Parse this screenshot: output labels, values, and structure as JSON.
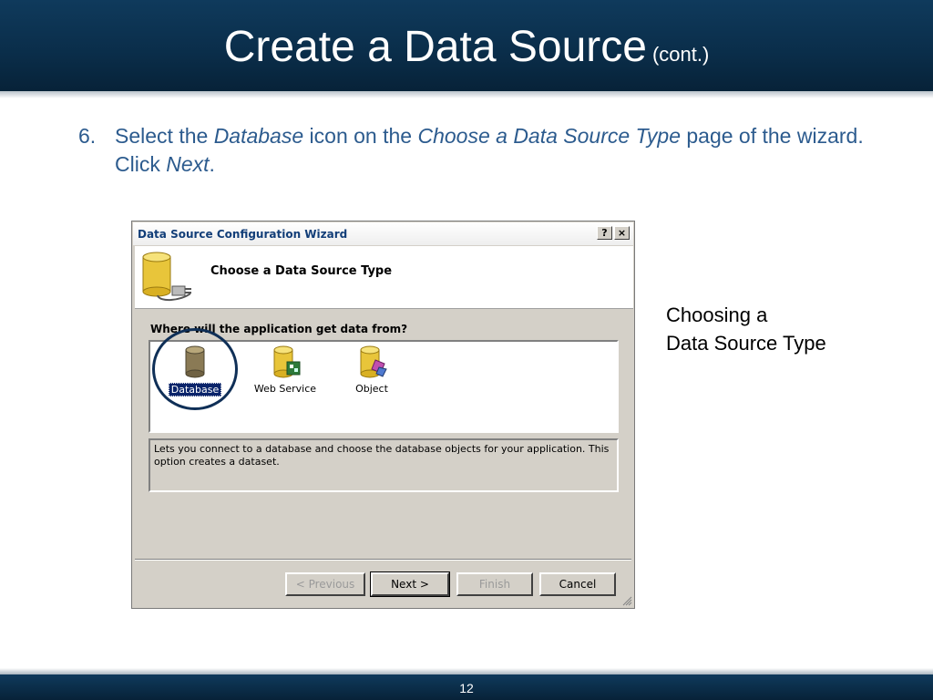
{
  "slide": {
    "title": "Create a Data Source",
    "title_suffix": "(cont.)",
    "step_number": "6.",
    "step_parts": [
      {
        "text": "Select the ",
        "italic": false
      },
      {
        "text": "Database",
        "italic": true
      },
      {
        "text": " icon on the ",
        "italic": false
      },
      {
        "text": "Choose a Data Source Type",
        "italic": true
      },
      {
        "text": " page of the wizard. Click ",
        "italic": false
      },
      {
        "text": "Next",
        "italic": true
      },
      {
        "text": ".",
        "italic": false
      }
    ],
    "caption_line1": "Choosing a",
    "caption_line2": "Data Source Type",
    "page_number": "12",
    "colors": {
      "header": "#0a2d49",
      "bullet_text": "#2c5b8e",
      "highlight_circle": "#0f2f57"
    }
  },
  "wizard": {
    "title": "Data Source Configuration Wizard",
    "help_button": "?",
    "close_button": "×",
    "header_text": "Choose a Data Source Type",
    "header_icon": "database-plug-icon",
    "question": "Where will the application get data from?",
    "items": [
      {
        "label": "Database",
        "icon": "database-icon",
        "selected": true
      },
      {
        "label": "Web Service",
        "icon": "web-service-icon",
        "selected": false
      },
      {
        "label": "Object",
        "icon": "object-icon",
        "selected": false
      }
    ],
    "description": "Lets you connect to a database and choose the database objects for your application. This option creates a dataset.",
    "buttons": {
      "previous": "< Previous",
      "next": "Next >",
      "finish": "Finish",
      "cancel": "Cancel"
    }
  }
}
